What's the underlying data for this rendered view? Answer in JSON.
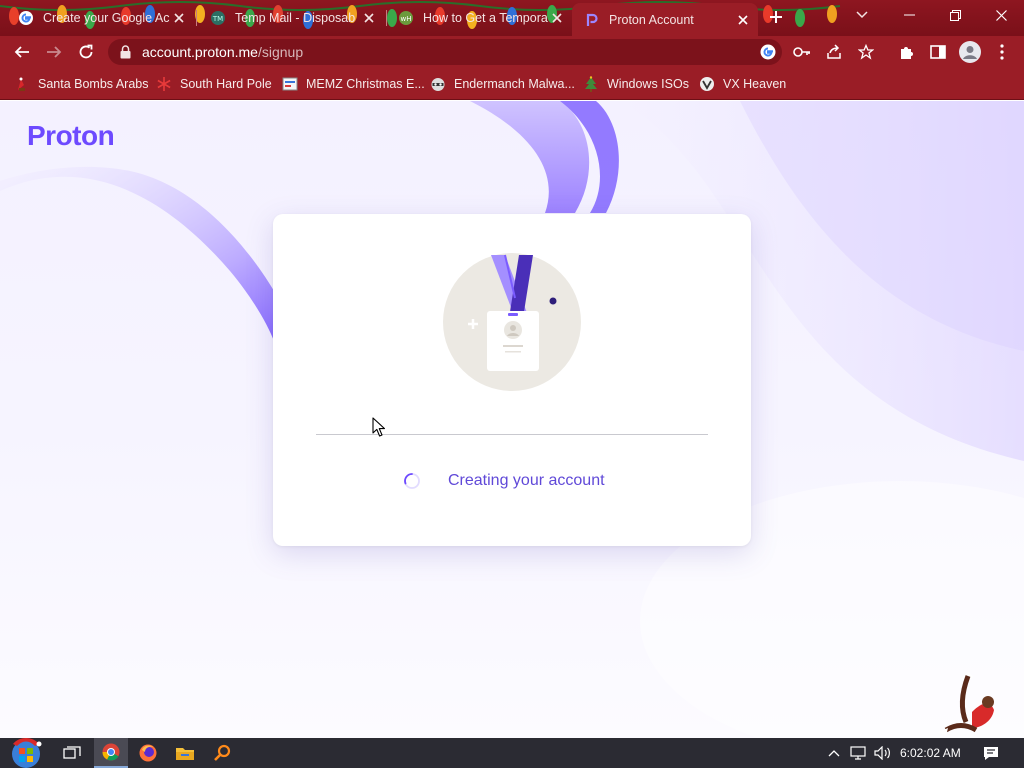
{
  "browser": {
    "tabs": [
      {
        "title": "Create your Google Ac",
        "favicon": "google-icon"
      },
      {
        "title": "Temp Mail - Disposab",
        "favicon": "tempmail-icon"
      },
      {
        "title": "How to Get a Tempora",
        "favicon": "wikihow-icon"
      },
      {
        "title": "Proton Account",
        "favicon": "proton-icon",
        "active": true
      }
    ],
    "new_tab_icon": "plus-icon",
    "tab_search_icon": "chevron-down-icon",
    "window_controls": [
      "minimize-icon",
      "restore-icon",
      "close-icon"
    ],
    "address": {
      "host": "account.proton.me",
      "path": "/signup"
    },
    "toolbar_icons": [
      "back-icon",
      "forward-icon",
      "reload-icon",
      "lock-icon",
      "google-lens-icon",
      "key-icon",
      "share-icon",
      "star-icon",
      "extensions-icon",
      "side-panel-icon",
      "profile-icon",
      "menu-icon"
    ],
    "bookmarks": [
      {
        "label": "Santa Bombs Arabs",
        "icon": "santa-icon"
      },
      {
        "label": "South Hard Pole",
        "icon": "snowflake-icon"
      },
      {
        "label": "MEMZ Christmas E...",
        "icon": "memz-icon"
      },
      {
        "label": "Endermanch Malwa...",
        "icon": "raccoon-icon"
      },
      {
        "label": "Windows ISOs",
        "icon": "tree-icon"
      },
      {
        "label": "VX Heaven",
        "icon": "vx-icon"
      }
    ]
  },
  "page": {
    "logo": "Proton",
    "status_text": "Creating your account",
    "colors": {
      "brand": "#6d4aff",
      "status_text": "#6049d8"
    }
  },
  "taskbar": {
    "icons": [
      "start-icon",
      "task-view-icon",
      "chrome-icon",
      "firefox-icon",
      "file-explorer-icon",
      "search-app-icon"
    ],
    "tray_icons": [
      "tray-chevron-icon",
      "network-icon",
      "volume-icon",
      "notifications-icon"
    ],
    "time": "6:02:02 AM"
  }
}
